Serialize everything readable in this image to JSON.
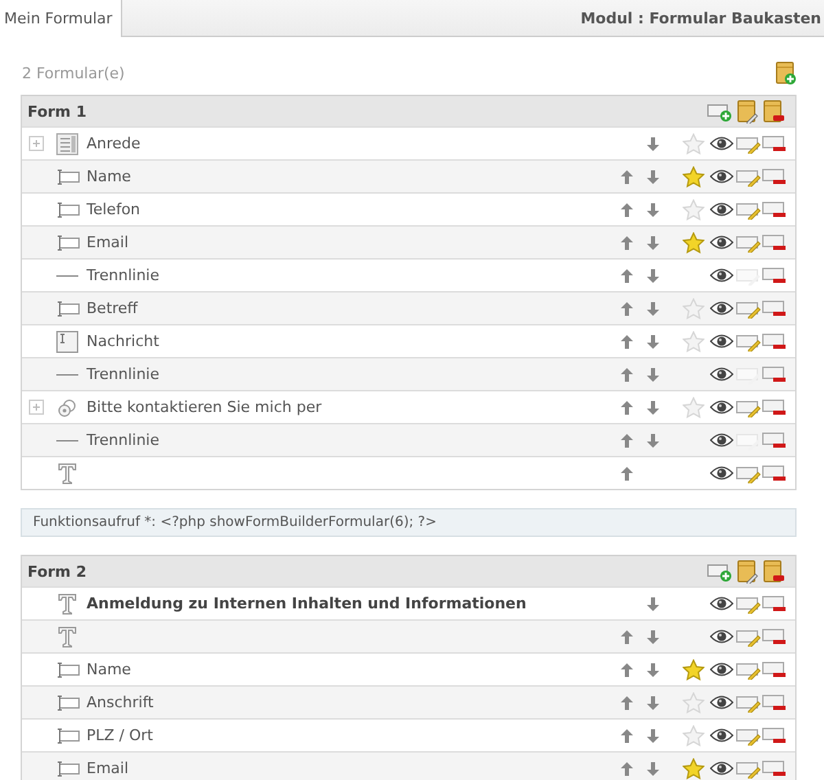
{
  "tabs": [
    {
      "label": "Mein Formular",
      "selected": true
    }
  ],
  "module_title": "Modul : Formular Baukasten",
  "form_count": "2 Formular(e)",
  "forms": [
    {
      "title": "Form 1",
      "function_call": "Funktionsaufruf *: <?php showFormBuilderFormular(6); ?>",
      "fields": [
        {
          "kind": "select",
          "label": "Anrede",
          "expandable": true,
          "move_up": false,
          "move_down": true,
          "required": false,
          "editable": true
        },
        {
          "kind": "text",
          "label": "Name",
          "expandable": false,
          "move_up": true,
          "move_down": true,
          "required": true,
          "editable": true
        },
        {
          "kind": "text",
          "label": "Telefon",
          "expandable": false,
          "move_up": true,
          "move_down": true,
          "required": false,
          "editable": true
        },
        {
          "kind": "text",
          "label": "Email",
          "expandable": false,
          "move_up": true,
          "move_down": true,
          "required": true,
          "editable": true
        },
        {
          "kind": "divider",
          "label": "Trennlinie",
          "expandable": false,
          "move_up": true,
          "move_down": true,
          "editable": false
        },
        {
          "kind": "text",
          "label": "Betreff",
          "expandable": false,
          "move_up": true,
          "move_down": true,
          "required": false,
          "editable": true
        },
        {
          "kind": "textarea",
          "label": "Nachricht",
          "expandable": false,
          "move_up": true,
          "move_down": true,
          "required": false,
          "editable": true
        },
        {
          "kind": "divider",
          "label": "Trennlinie",
          "expandable": false,
          "move_up": true,
          "move_down": true,
          "editable": false
        },
        {
          "kind": "checkgroup",
          "label": "Bitte kontaktieren Sie mich per",
          "expandable": true,
          "move_up": true,
          "move_down": true,
          "required": false,
          "editable": true
        },
        {
          "kind": "divider",
          "label": "Trennlinie",
          "expandable": false,
          "move_up": true,
          "move_down": true,
          "editable": false
        },
        {
          "kind": "heading",
          "expandable": false,
          "move_up": true,
          "move_down": false,
          "editable": true
        }
      ]
    },
    {
      "title": "Form 2",
      "fields": [
        {
          "kind": "heading",
          "label": "Anmeldung zu Internen Inhalten und Informationen",
          "expandable": false,
          "move_up": false,
          "move_down": true,
          "editable": true
        },
        {
          "kind": "heading",
          "expandable": false,
          "move_up": true,
          "move_down": true,
          "editable": true
        },
        {
          "kind": "text",
          "label": "Name",
          "expandable": false,
          "move_up": true,
          "move_down": true,
          "required": true,
          "editable": true
        },
        {
          "kind": "text",
          "label": "Anschrift",
          "expandable": false,
          "move_up": true,
          "move_down": true,
          "required": false,
          "editable": true
        },
        {
          "kind": "text",
          "label": "PLZ / Ort",
          "expandable": false,
          "move_up": true,
          "move_down": true,
          "required": false,
          "editable": true
        },
        {
          "kind": "text",
          "label": "Email",
          "expandable": false,
          "move_up": true,
          "move_down": true,
          "required": true,
          "editable": true
        }
      ]
    }
  ]
}
